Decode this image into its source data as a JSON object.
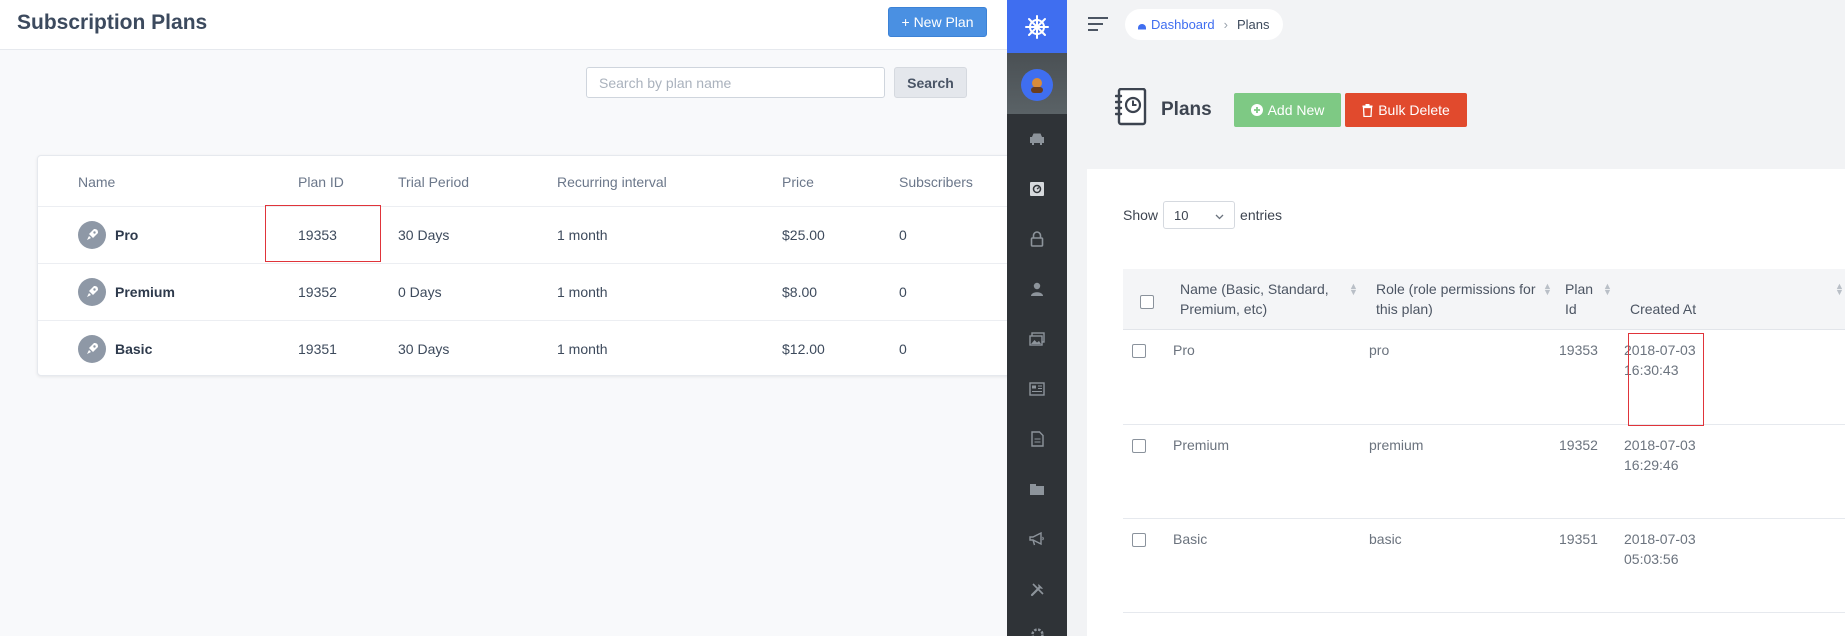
{
  "left": {
    "title": "Subscription Plans",
    "new_plan_label": "+ New Plan",
    "search": {
      "placeholder": "Search by plan name",
      "value": "",
      "button_label": "Search"
    },
    "columns": [
      "Name",
      "Plan ID",
      "Trial Period",
      "Recurring interval",
      "Price",
      "Subscribers"
    ],
    "rows": [
      {
        "name": "Pro",
        "plan_id": "19353",
        "trial": "30 Days",
        "interval": "1 month",
        "price": "$25.00",
        "subscribers": "0"
      },
      {
        "name": "Premium",
        "plan_id": "19352",
        "trial": "0 Days",
        "interval": "1 month",
        "price": "$8.00",
        "subscribers": "0"
      },
      {
        "name": "Basic",
        "plan_id": "19351",
        "trial": "30 Days",
        "interval": "1 month",
        "price": "$12.00",
        "subscribers": "0"
      }
    ]
  },
  "right": {
    "breadcrumb": {
      "home": "Dashboard",
      "current": "Plans"
    },
    "page_title": "Plans",
    "add_new_label": "Add New",
    "bulk_delete_label": "Bulk Delete",
    "show_label": "Show",
    "entries_value": "10",
    "entries_label": "entries",
    "columns": {
      "name_line1": "Name (Basic, Standard,",
      "name_line2": "Premium, etc)",
      "role_line1": "Role (role permissions for",
      "role_line2": "this plan)",
      "planid_line1": "Plan",
      "planid_line2": "Id",
      "created": "Created At"
    },
    "rows": [
      {
        "name": "Pro",
        "role": "pro",
        "plan_id": "19353",
        "created_date": "2018-07-03",
        "created_time": "16:30:43"
      },
      {
        "name": "Premium",
        "role": "premium",
        "plan_id": "19352",
        "created_date": "2018-07-03",
        "created_time": "16:29:46"
      },
      {
        "name": "Basic",
        "role": "basic",
        "plan_id": "19351",
        "created_date": "2018-07-03",
        "created_time": "05:03:56"
      }
    ]
  },
  "sidebar_icons": [
    "car-icon",
    "vault-icon",
    "lock-icon",
    "user-icon",
    "images-icon",
    "newspaper-icon",
    "document-icon",
    "folder-icon",
    "megaphone-icon",
    "tools-icon",
    "settings-icon"
  ],
  "colors": {
    "primary": "#4a90e2",
    "sidebar": "#2f3337",
    "sidebar_logo": "#3f6ef0",
    "add_new": "#7ec984",
    "bulk_delete": "#e14a2d",
    "highlight": "#e0343a"
  }
}
